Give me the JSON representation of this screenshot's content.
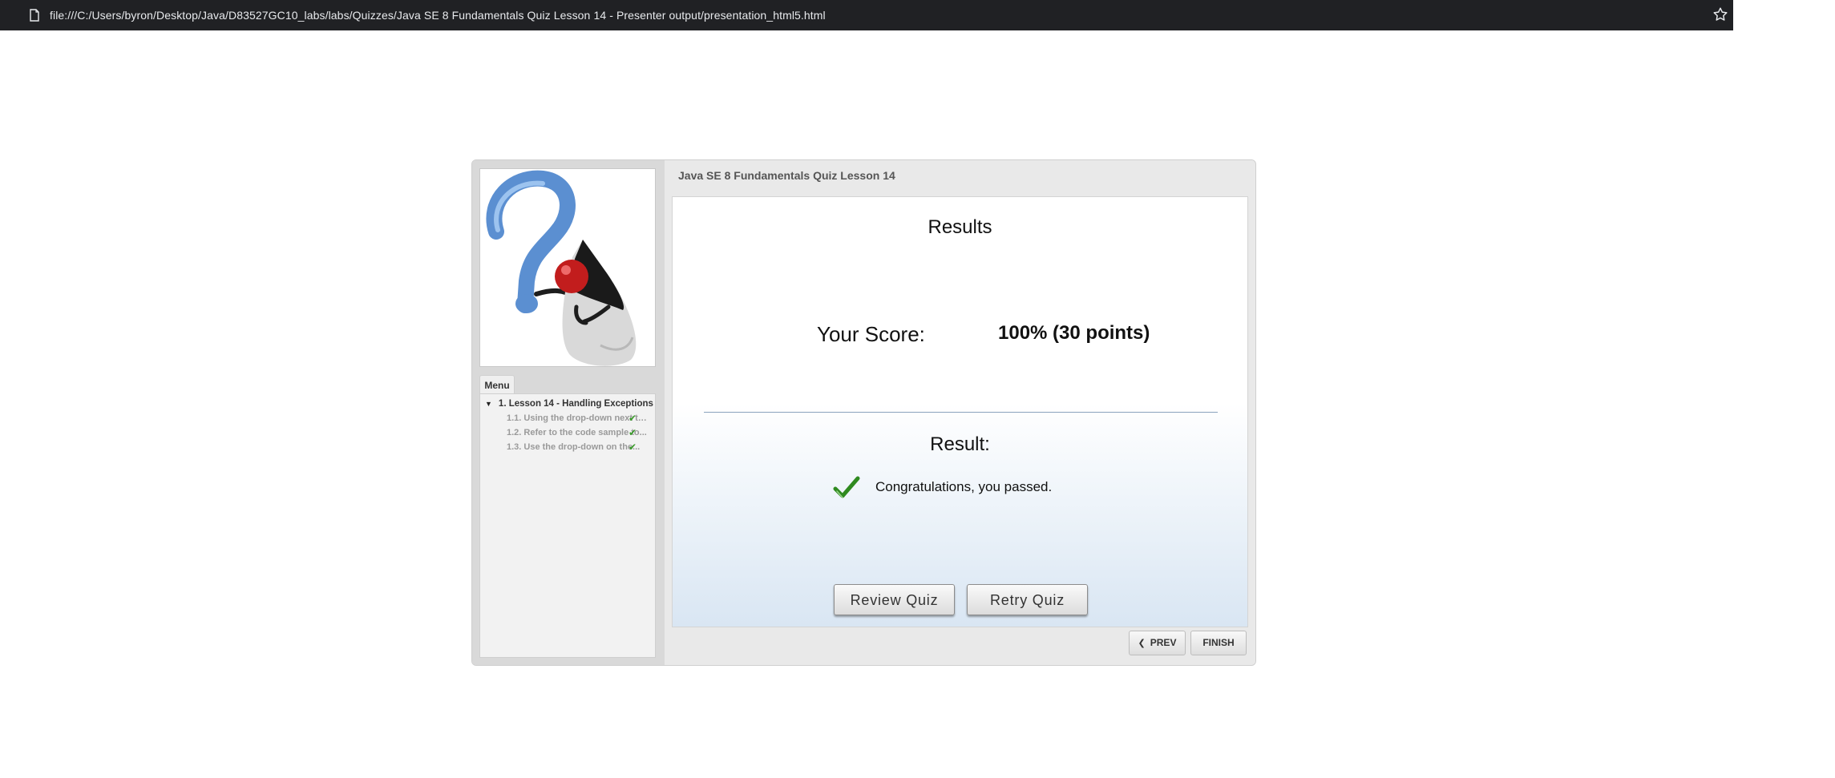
{
  "browser": {
    "url": "file:///C:/Users/byron/Desktop/Java/D83527GC10_labs/labs/Quizzes/Java SE 8 Fundamentals Quiz Lesson 14 - Presenter output/presentation_html5.html",
    "page_icon": "file-icon",
    "bookmark_icon": "star-icon"
  },
  "sidebar": {
    "logo": "duke-question-mark-logo",
    "menu_tab": "Menu",
    "section": "1. Lesson 14 - Handling Exceptions",
    "items": [
      {
        "label": "1.1. Using the drop-down next to each...",
        "completed": true
      },
      {
        "label": "1.2. Refer to the code sample to...",
        "completed": true
      },
      {
        "label": "1.3. Use the drop-down on the...",
        "completed": true
      }
    ]
  },
  "main": {
    "title": "Java SE 8 Fundamentals Quiz Lesson 14",
    "results_heading": "Results",
    "score_label": "Your Score:",
    "score_value": "100% (30 points)",
    "result_label": "Result:",
    "pass_message": "Congratulations, you passed.",
    "review_button": "Review Quiz",
    "retry_button": "Retry Quiz",
    "prev_button": "PREV",
    "finish_button": "FINISH"
  },
  "colors": {
    "check_green": "#2f8a1f",
    "url_bar_bg": "#202124"
  }
}
